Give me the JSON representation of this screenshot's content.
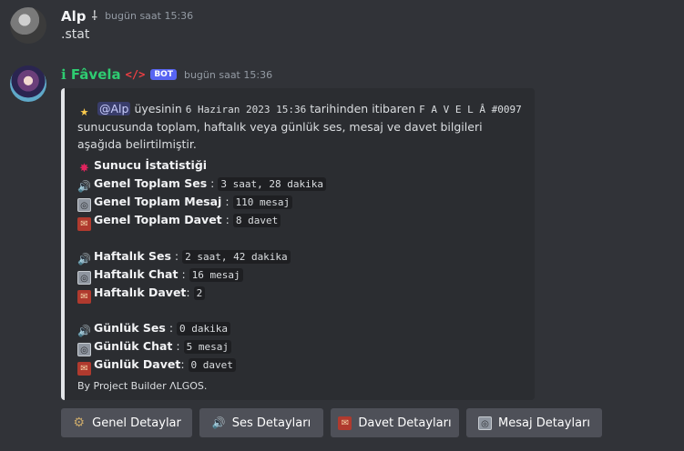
{
  "message1": {
    "author": "Alp",
    "badge_icon": "dagger-icon",
    "timestamp": "bugün saat 15:36",
    "content": ".stat"
  },
  "message2": {
    "author": "ℹ Fâvela",
    "code_icon": "</>",
    "bot_tag": "BOT",
    "timestamp": "bugün saat 15:36",
    "embed": {
      "intro_mention": "@Alp",
      "intro_text1": "üyesinin",
      "intro_date": "6 Haziran 2023 15:36",
      "intro_text2": "tarihinden itibaren",
      "intro_server": "F A V E L Â #0097",
      "intro_text3": "sunucusunda toplam, haftalık veya günlük ses, mesaj ve davet bilgileri aşağıda belirtilmiştir.",
      "section_title": "Sunucu İstatistiği",
      "general": [
        {
          "label": "Genel Toplam Ses",
          "sep": ":",
          "value": "3 saat, 28 dakika",
          "icon": "speaker-icon"
        },
        {
          "label": "Genel Toplam Mesaj",
          "sep": ":",
          "value": "110 mesaj",
          "icon": "message-box-icon"
        },
        {
          "label": "Genel Toplam Davet",
          "sep": ":",
          "value": "8 davet",
          "icon": "invite-icon"
        }
      ],
      "weekly": [
        {
          "label": "Haftalık Ses",
          "sep": ":",
          "value": "2 saat, 42 dakika",
          "icon": "speaker-icon"
        },
        {
          "label": "Haftalık Chat",
          "sep": ":",
          "value": "16 mesaj",
          "icon": "message-box-icon"
        },
        {
          "label": "Haftalık Davet",
          "sep": ":",
          "value": "2",
          "icon": "invite-icon"
        }
      ],
      "daily": [
        {
          "label": "Günlük Ses",
          "sep": ":",
          "value": "0 dakika",
          "icon": "speaker-icon"
        },
        {
          "label": "Günlük Chat",
          "sep": ":",
          "value": "5 mesaj",
          "icon": "message-box-icon"
        },
        {
          "label": "Günlük Davet",
          "sep": ":",
          "value": "0 davet",
          "icon": "invite-icon"
        }
      ],
      "footer": "By Project Builder ΛLGOS."
    },
    "buttons": [
      {
        "label": "Genel Detaylar",
        "icon": "gear-icon"
      },
      {
        "label": "Ses Detayları",
        "icon": "speaker-icon"
      },
      {
        "label": "Davet Detayları",
        "icon": "invite-icon"
      },
      {
        "label": "Mesaj Detayları",
        "icon": "message-box-icon"
      }
    ]
  }
}
